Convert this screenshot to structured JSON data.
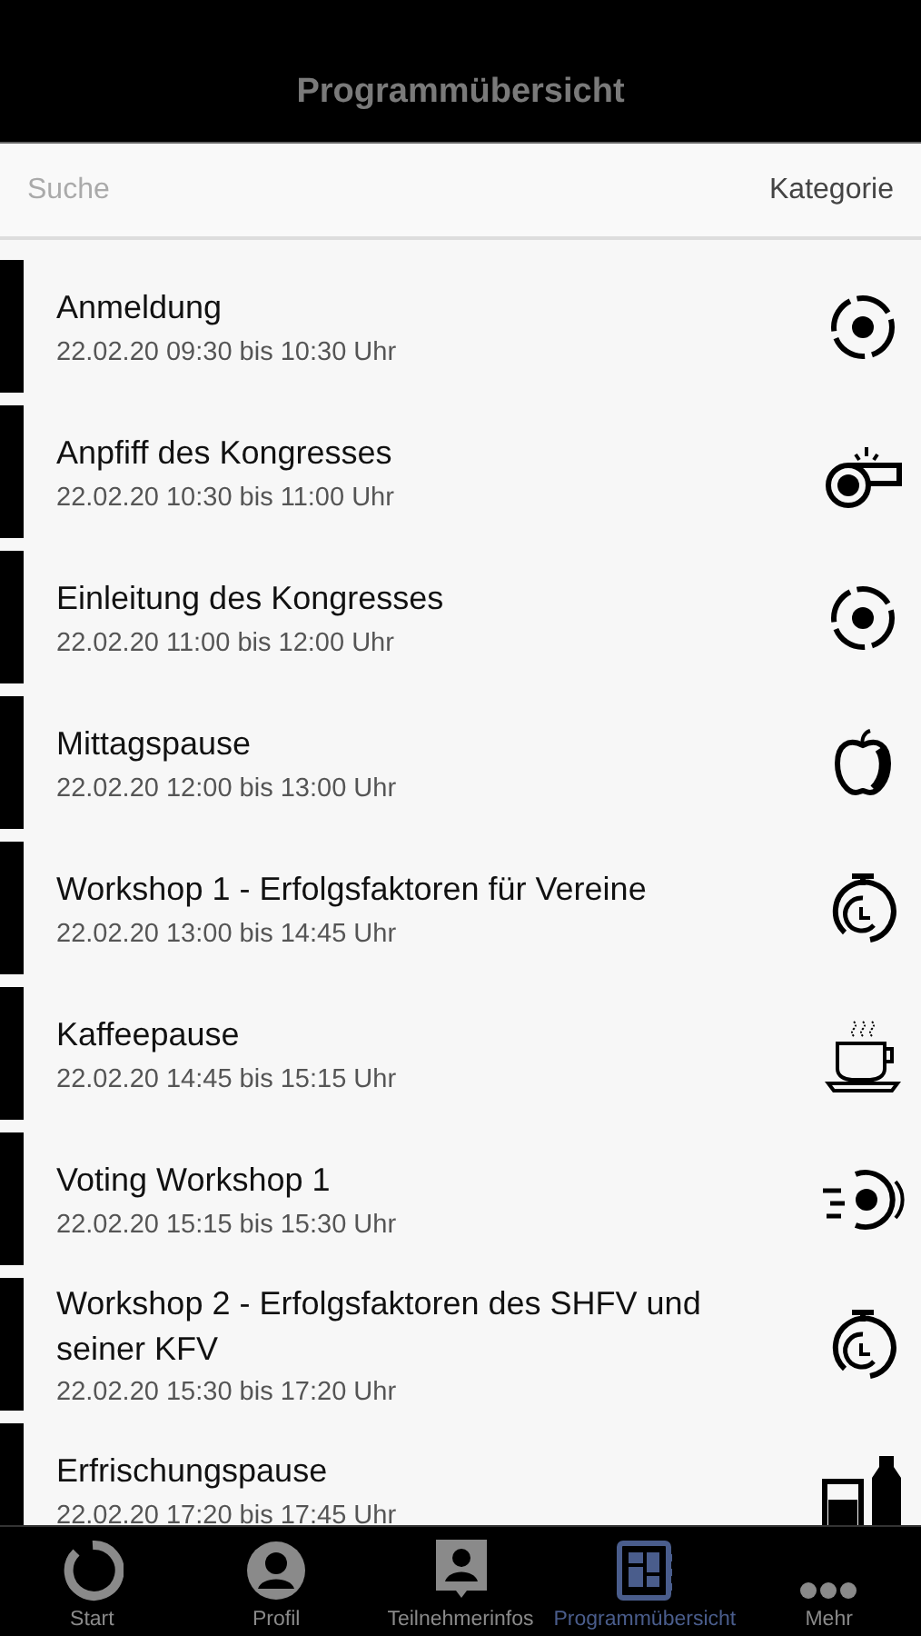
{
  "header": {
    "title": "Programmübersicht"
  },
  "search": {
    "placeholder": "Suche",
    "category": "Kategorie"
  },
  "events": [
    {
      "title": "Anmeldung",
      "time": "22.02.20 09:30 bis 10:30 Uhr",
      "kind": "ball"
    },
    {
      "title": "Anpfiff des Kongresses",
      "time": "22.02.20 10:30 bis 11:00 Uhr",
      "kind": "whistle"
    },
    {
      "title": "Einleitung des Kongresses",
      "time": "22.02.20 11:00 bis 12:00 Uhr",
      "kind": "ball"
    },
    {
      "title": "Mittagspause",
      "time": "22.02.20 12:00 bis 13:00 Uhr",
      "kind": "apple"
    },
    {
      "title": "Workshop 1 - Erfolgsfaktoren für Vereine",
      "time": "22.02.20 13:00 bis 14:45 Uhr",
      "kind": "stopwatch"
    },
    {
      "title": "Kaffeepause",
      "time": "22.02.20 14:45 bis 15:15 Uhr",
      "kind": "coffee"
    },
    {
      "title": "Voting Workshop 1",
      "time": "22.02.20 15:15 bis 15:30 Uhr",
      "kind": "flying-ball"
    },
    {
      "title": "Workshop 2 - Erfolgsfaktoren des SHFV und seiner KFV",
      "time": "22.02.20 15:30 bis 17:20 Uhr",
      "kind": "stopwatch"
    },
    {
      "title": "Erfrischungspause",
      "time": "22.02.20 17:20 bis 17:45 Uhr",
      "kind": "drinks"
    }
  ],
  "tabs": [
    {
      "label": "Start",
      "kind": "ring",
      "selected": false
    },
    {
      "label": "Profil",
      "kind": "person",
      "selected": false
    },
    {
      "label": "Teilnehmerinfos",
      "kind": "badge",
      "selected": false
    },
    {
      "label": "Programmübersicht",
      "kind": "program",
      "selected": true
    },
    {
      "label": "Mehr",
      "kind": "more",
      "selected": false
    }
  ]
}
